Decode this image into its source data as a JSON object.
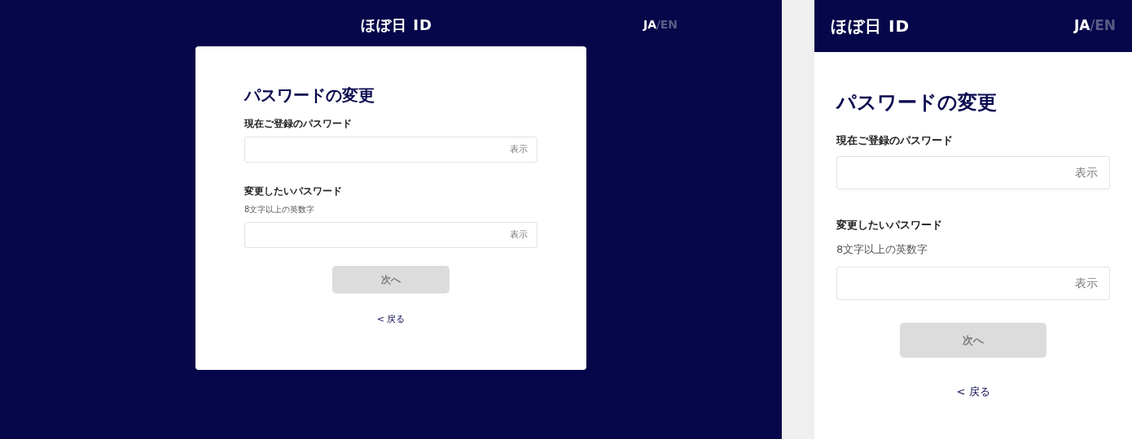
{
  "views": [
    {
      "kind": "desktop",
      "logo": "ほぼ日 ID",
      "languages": [
        {
          "label": "JA",
          "selected": true
        },
        {
          "label": "EN",
          "selected": false
        }
      ],
      "language_separator": "/",
      "title": "パスワードの変更",
      "fields": [
        {
          "label": "現在ご登録のパスワード",
          "toggle": "表示"
        },
        {
          "label": "変更したいパスワード",
          "hint": "8文字以上の英数字",
          "toggle": "表示"
        }
      ],
      "button": {
        "label": "次へ",
        "disabled": true
      },
      "back_link": "< 戻る"
    },
    {
      "kind": "mobile",
      "logo": "ほぼ日 ID",
      "languages": [
        {
          "label": "JA",
          "selected": true
        },
        {
          "label": "EN",
          "selected": false
        }
      ],
      "language_separator": "/",
      "title": "パスワードの変更",
      "fields": [
        {
          "label": "現在ご登録のパスワード",
          "toggle": "表示"
        },
        {
          "label": "変更したいパスワード",
          "hint": "8文字以上の英数字",
          "toggle": "表示"
        }
      ],
      "button": {
        "label": "次へ",
        "disabled": true
      },
      "back_link": "< 戻る"
    }
  ]
}
